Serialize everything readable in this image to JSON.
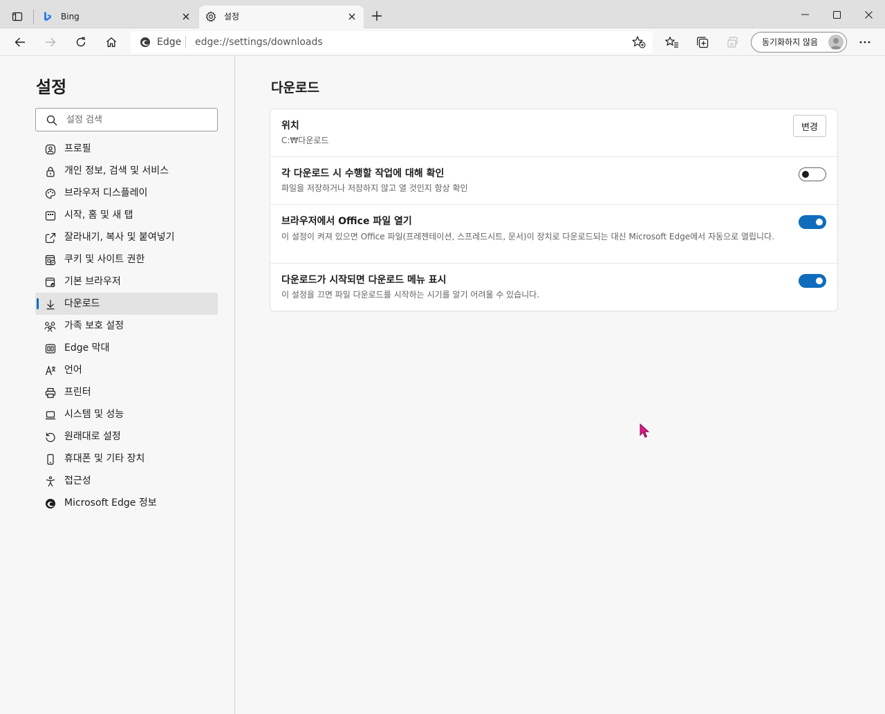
{
  "colors": {
    "accent": "#0f6cbd",
    "cursor": "#e0178c"
  },
  "tabs": [
    {
      "title": "Bing",
      "icon": "bing-icon"
    },
    {
      "title": "설정",
      "icon": "gear-icon"
    }
  ],
  "toolbar": {
    "site_label": "Edge",
    "url": "edge://settings/downloads",
    "profile_label": "동기화하지 않음"
  },
  "sidebar": {
    "title": "설정",
    "search_placeholder": "설정 검색",
    "items": [
      {
        "label": "프로필",
        "icon": "profile-icon"
      },
      {
        "label": "개인 정보, 검색 및 서비스",
        "icon": "lock-icon"
      },
      {
        "label": "브라우저 디스플레이",
        "icon": "palette-icon"
      },
      {
        "label": "시작, 홈 및 새 탭",
        "icon": "start-page-icon"
      },
      {
        "label": "잘라내기, 복사 및 붙여넣기",
        "icon": "share-icon"
      },
      {
        "label": "쿠키 및 사이트 권한",
        "icon": "site-permissions-icon"
      },
      {
        "label": "기본 브라우저",
        "icon": "default-browser-icon"
      },
      {
        "label": "다운로드",
        "icon": "download-icon",
        "selected": true
      },
      {
        "label": "가족 보호 설정",
        "icon": "family-icon"
      },
      {
        "label": "Edge 막대",
        "icon": "edge-bar-icon"
      },
      {
        "label": "언어",
        "icon": "language-icon"
      },
      {
        "label": "프린터",
        "icon": "printer-icon"
      },
      {
        "label": "시스템 및 성능",
        "icon": "laptop-icon"
      },
      {
        "label": "원래대로 설정",
        "icon": "reset-icon"
      },
      {
        "label": "휴대폰 및 기타 장치",
        "icon": "phone-icon"
      },
      {
        "label": "접근성",
        "icon": "accessibility-icon"
      },
      {
        "label": "Microsoft Edge 정보",
        "icon": "edge-logo-icon"
      }
    ]
  },
  "main": {
    "title": "다운로드",
    "location": {
      "title": "위치",
      "path": "C:₩다운로드",
      "change_label": "변경"
    },
    "settings": [
      {
        "title": "각 다운로드 시 수행할 작업에 대해 확인",
        "desc": "파일을 저장하거나 저장하지 않고 열 것인지 항상 확인",
        "enabled": false
      },
      {
        "title": "브라우저에서 Office 파일 열기",
        "desc": "이 설정이 켜져 있으면 Office 파일(프레젠테이션, 스프레드시트, 문서)이 장치로 다운로드되는 대신 Microsoft Edge에서 자동으로 열립니다.",
        "enabled": true
      },
      {
        "title": "다운로드가 시작되면 다운로드 메뉴 표시",
        "desc": "이 설정을 끄면 파일 다운로드를 시작하는 시기를 알기 어려울 수 있습니다.",
        "enabled": true
      }
    ]
  }
}
